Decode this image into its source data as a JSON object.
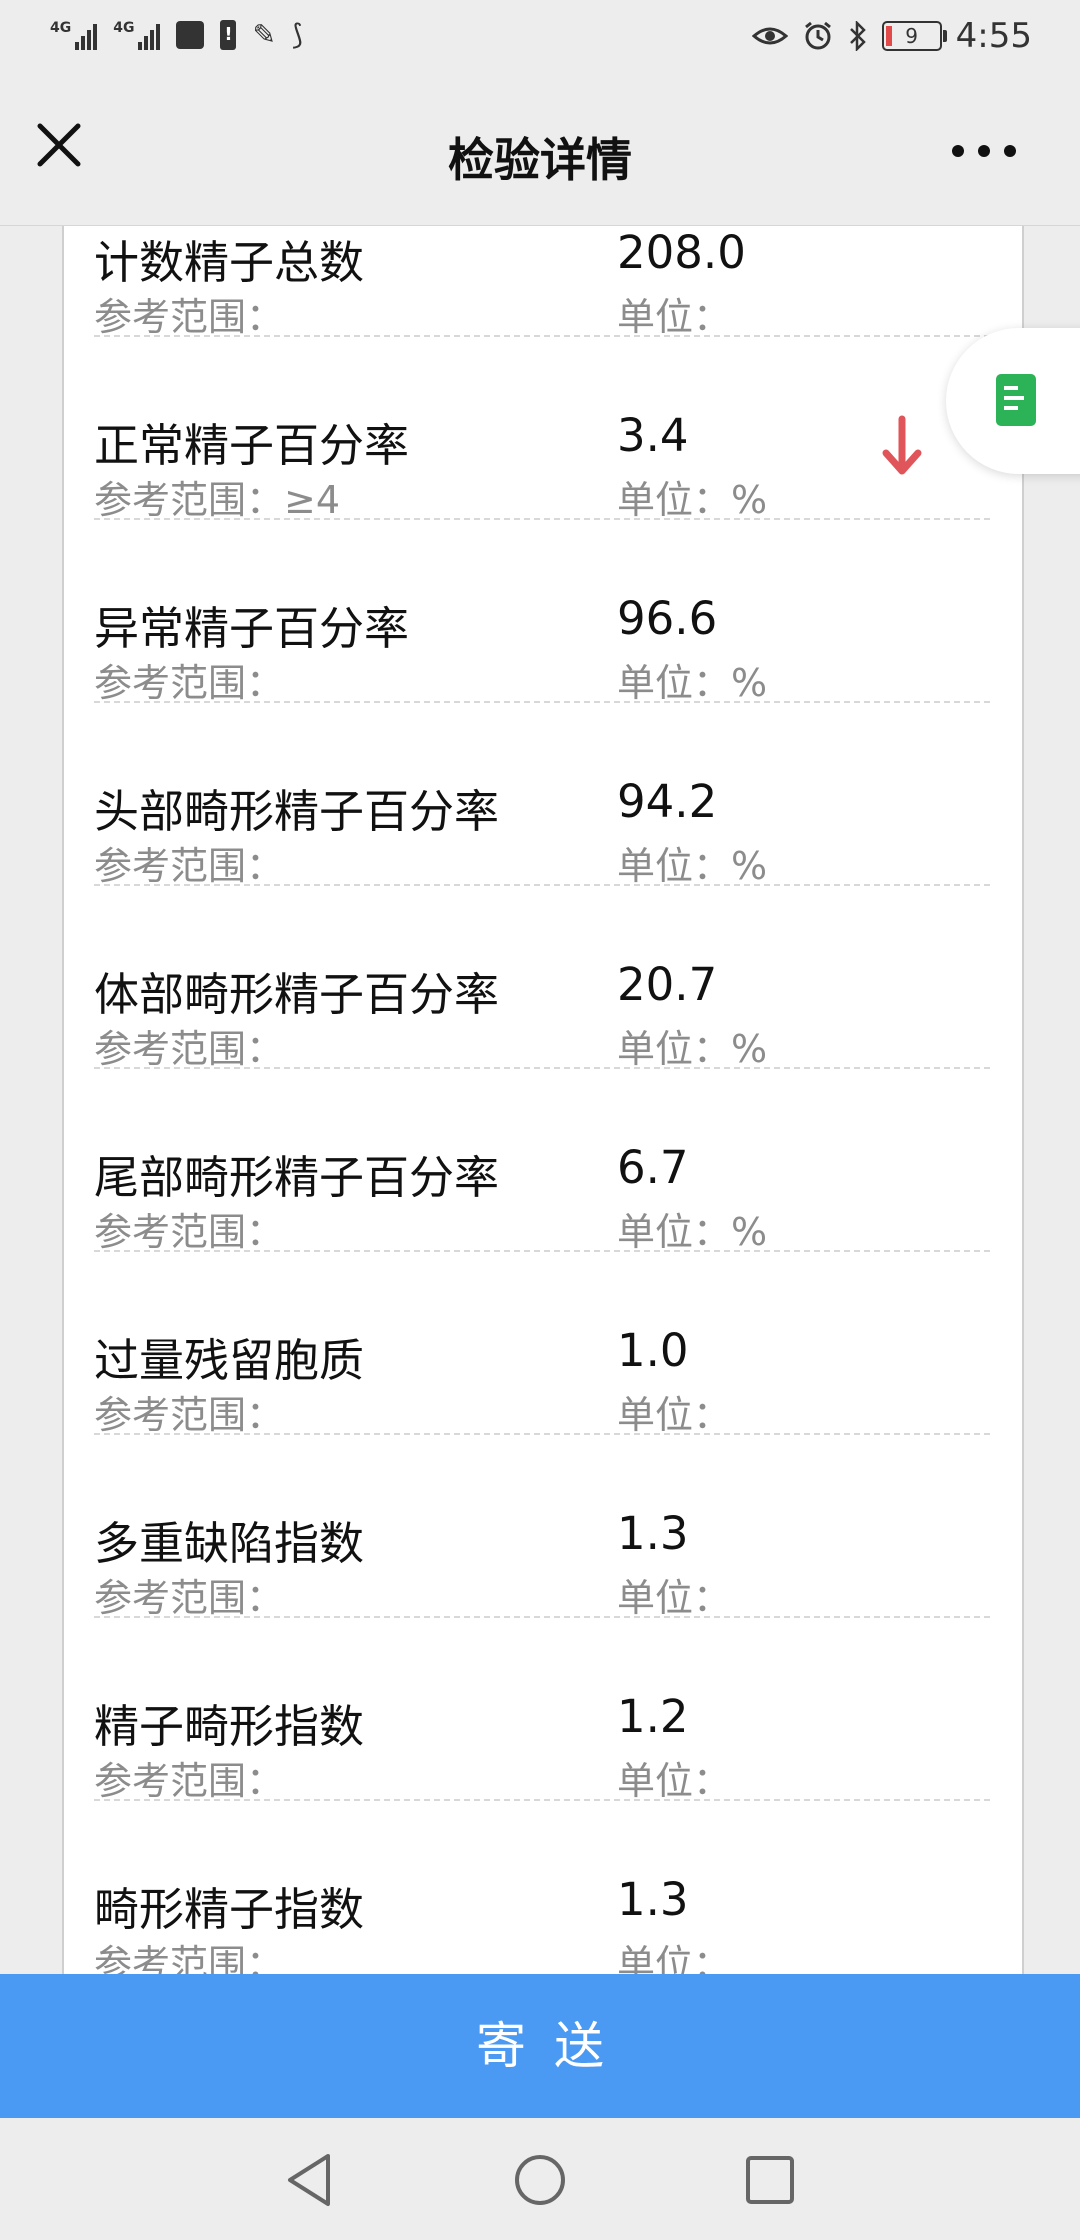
{
  "status_bar": {
    "network1": "4G",
    "network2": "4G",
    "battery_level": "9",
    "time": "4:55"
  },
  "header": {
    "title": "检验详情"
  },
  "rows": [
    {
      "name": "计数精子总数",
      "value": "208.0",
      "ref_label": "参考范围：",
      "ref_value": "",
      "unit_label": "单位：",
      "unit_value": "",
      "flag": ""
    },
    {
      "name": "正常精子百分率",
      "value": "3.4",
      "ref_label": "参考范围：",
      "ref_value": "≥4",
      "unit_label": "单位：",
      "unit_value": "%",
      "flag": "low"
    },
    {
      "name": "异常精子百分率",
      "value": "96.6",
      "ref_label": "参考范围：",
      "ref_value": "",
      "unit_label": "单位：",
      "unit_value": "%",
      "flag": ""
    },
    {
      "name": "头部畸形精子百分率",
      "value": "94.2",
      "ref_label": "参考范围：",
      "ref_value": "",
      "unit_label": "单位：",
      "unit_value": "%",
      "flag": ""
    },
    {
      "name": "体部畸形精子百分率",
      "value": "20.7",
      "ref_label": "参考范围：",
      "ref_value": "",
      "unit_label": "单位：",
      "unit_value": "%",
      "flag": ""
    },
    {
      "name": "尾部畸形精子百分率",
      "value": "6.7",
      "ref_label": "参考范围：",
      "ref_value": "",
      "unit_label": "单位：",
      "unit_value": "%",
      "flag": ""
    },
    {
      "name": "过量残留胞质",
      "value": "1.0",
      "ref_label": "参考范围：",
      "ref_value": "",
      "unit_label": "单位：",
      "unit_value": "",
      "flag": ""
    },
    {
      "name": "多重缺陷指数",
      "value": "1.3",
      "ref_label": "参考范围：",
      "ref_value": "",
      "unit_label": "单位：",
      "unit_value": "",
      "flag": ""
    },
    {
      "name": "精子畸形指数",
      "value": "1.2",
      "ref_label": "参考范围：",
      "ref_value": "",
      "unit_label": "单位：",
      "unit_value": "",
      "flag": ""
    },
    {
      "name": "畸形精子指数",
      "value": "1.3",
      "ref_label": "参考范围：",
      "ref_value": "",
      "unit_label": "单位：",
      "unit_value": "",
      "flag": ""
    }
  ],
  "footer": {
    "send_label": "寄送"
  },
  "colors": {
    "accent": "#4a9af4",
    "flag_low": "#e0555a",
    "doc_icon": "#2db357"
  },
  "icons": {
    "close": "close-icon",
    "more": "more-icon",
    "doc": "document-icon",
    "low_flag": "arrow-down-icon"
  }
}
